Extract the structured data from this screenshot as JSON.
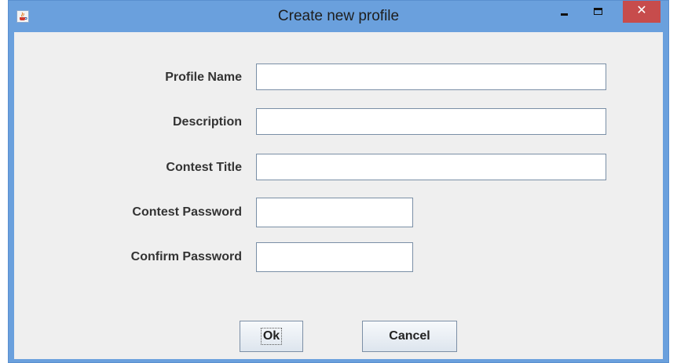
{
  "window": {
    "title": "Create new profile",
    "icon": "java-cup-icon",
    "controls": {
      "minimize": "minimize-icon",
      "maximize": "maximize-icon",
      "close_label": "✕"
    },
    "colors": {
      "titlebar": "#6aa0dd",
      "close": "#c74c4c",
      "client": "#efefef"
    }
  },
  "form": {
    "profile_name": {
      "label": "Profile Name",
      "value": ""
    },
    "description": {
      "label": "Description",
      "value": ""
    },
    "contest_title": {
      "label": "Contest Title",
      "value": ""
    },
    "contest_password": {
      "label": "Contest Password",
      "value": ""
    },
    "confirm_password": {
      "label": "Confirm Password",
      "value": ""
    }
  },
  "buttons": {
    "ok_label": "Ok",
    "cancel_label": "Cancel"
  }
}
